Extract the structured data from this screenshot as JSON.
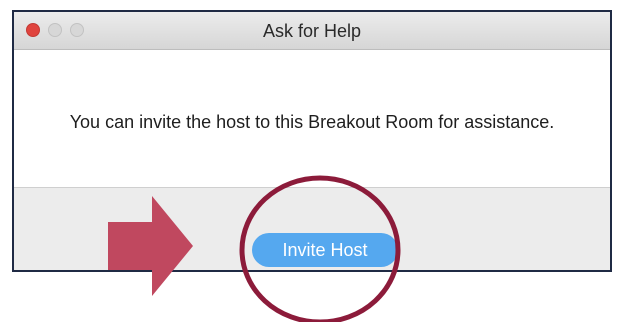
{
  "window": {
    "title": "Ask for Help"
  },
  "dialog": {
    "message": "You can invite the host to this Breakout Room for assistance.",
    "invite_button_label": "Invite Host"
  },
  "annotation": {
    "arrow_color": "#c0485f",
    "circle_color": "#8c1b3a"
  },
  "colors": {
    "button": "#55a8ef",
    "close_light": "#e0443e"
  }
}
